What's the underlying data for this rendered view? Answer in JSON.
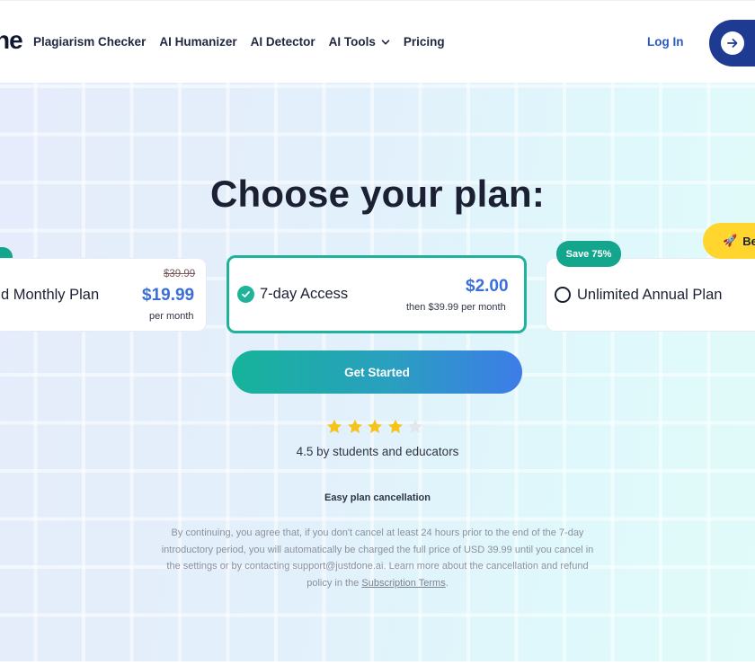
{
  "header": {
    "logo_text": "ne",
    "nav": [
      {
        "label": "Plagiarism Checker"
      },
      {
        "label": "AI Humanizer"
      },
      {
        "label": "AI Detector"
      },
      {
        "label": "AI Tools",
        "has_dropdown": true
      },
      {
        "label": "Pricing"
      }
    ],
    "login_label": "Log In",
    "cta_icon": "arrow-right-icon"
  },
  "main": {
    "title": "Choose your plan:",
    "plans": {
      "left": {
        "name": "d Monthly Plan",
        "old_price": "$39.99",
        "price": "$19.99",
        "price_sub": "per month"
      },
      "middle": {
        "name": "7-day Access",
        "price": "$2.00",
        "price_sub": "then $39.99 per month",
        "selected": true
      },
      "right": {
        "name": "Unlimited Annual Plan",
        "save_badge": "Save 75%",
        "best_badge": "Be",
        "selected": false
      }
    },
    "cta_label": "Get Started",
    "rating": {
      "value": 4.5,
      "max": 5,
      "text": "4.5 by students and educators"
    },
    "cancel_text": "Easy plan cancellation",
    "legal": {
      "text": "By continuing, you agree that, if you don't cancel at least 24 hours prior to the end of the 7-day introductory period, you will automatically be charged the full price of USD 39.99 until you cancel in the settings or by contacting support@justdone.ai. Learn more about the cancellation and refund policy in the ",
      "link": "Subscription Terms",
      "suffix": "."
    }
  },
  "colors": {
    "accent_teal": "#1fb39b",
    "price_blue": "#3b6fd8",
    "star_gold": "#f7c21a",
    "badge_yellow": "#ffd52e",
    "navy": "#1f3a91"
  }
}
